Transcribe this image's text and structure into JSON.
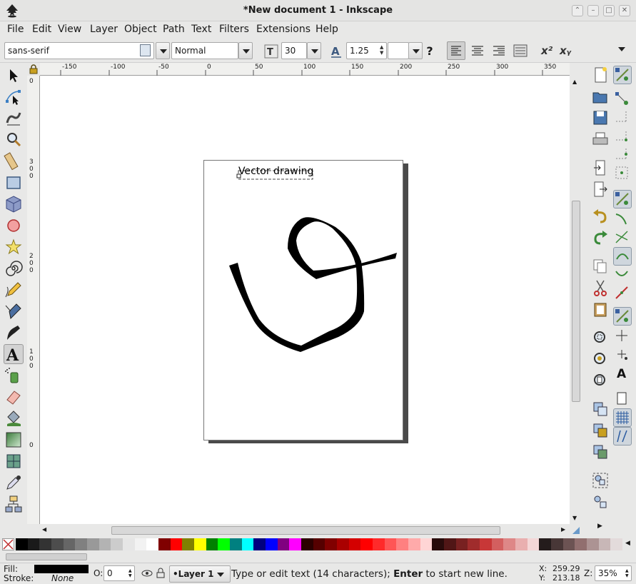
{
  "window": {
    "title": "*New document 1 - Inkscape"
  },
  "menu": [
    "File",
    "Edit",
    "View",
    "Layer",
    "Object",
    "Path",
    "Text",
    "Filters",
    "Extensions",
    "Help"
  ],
  "text_toolbar": {
    "font_family": "sans-serif",
    "font_style": "Normal",
    "font_size": "30",
    "line_spacing": "1.25",
    "help_glyph": "?",
    "superscript_glyph": "x²",
    "subscript_glyph": "xᵧ"
  },
  "ruler": {
    "h_labels": [
      "-150",
      "-100",
      "-50",
      "0",
      "50",
      "100",
      "150",
      "200",
      "250",
      "300",
      "350"
    ],
    "v_labels": [
      "0",
      "3 0 0",
      "2 0 0",
      "1 0 0",
      "0"
    ]
  },
  "canvas": {
    "text_object": "Vector drawing",
    "stroke_color": "#000000",
    "page_color": "#ffffff"
  },
  "palette": [
    "#000000",
    "#1a1a1a",
    "#333333",
    "#4d4d4d",
    "#666666",
    "#808080",
    "#999999",
    "#b3b3b3",
    "#cccccc",
    "#e6e6e6",
    "#f2f2f2",
    "#ffffff",
    "#800000",
    "#ff0000",
    "#808000",
    "#ffff00",
    "#008000",
    "#00ff00",
    "#008080",
    "#00ffff",
    "#000080",
    "#0000ff",
    "#800080",
    "#ff00ff",
    "#2b0000",
    "#550000",
    "#800000",
    "#aa0000",
    "#d40000",
    "#ff0000",
    "#ff2a2a",
    "#ff5555",
    "#ff8080",
    "#ffaaaa",
    "#ffd5d5",
    "#280b0b",
    "#501616",
    "#782121",
    "#a02c2c",
    "#c83737",
    "#d35f5f",
    "#de8787",
    "#e9afaf",
    "#f4d7d7",
    "#241c1c",
    "#483737",
    "#6c5353",
    "#916f6f",
    "#ac9393",
    "#c8b7b7",
    "#e3dbdb"
  ],
  "status": {
    "fill_label": "Fill:",
    "stroke_label": "Stroke:",
    "fill_color": "#000000",
    "stroke_value": "None",
    "opacity_label": "O:",
    "opacity_value": "0",
    "layer": "•Layer 1",
    "message_pre": "Type or edit text (14 characters); ",
    "message_bold": "Enter",
    "message_post": " to start new line.",
    "x_label": "X:",
    "x_value": "259.29",
    "y_label": "Y:",
    "y_value": "213.18",
    "zoom_label": "Z:",
    "zoom_value": "35%"
  }
}
